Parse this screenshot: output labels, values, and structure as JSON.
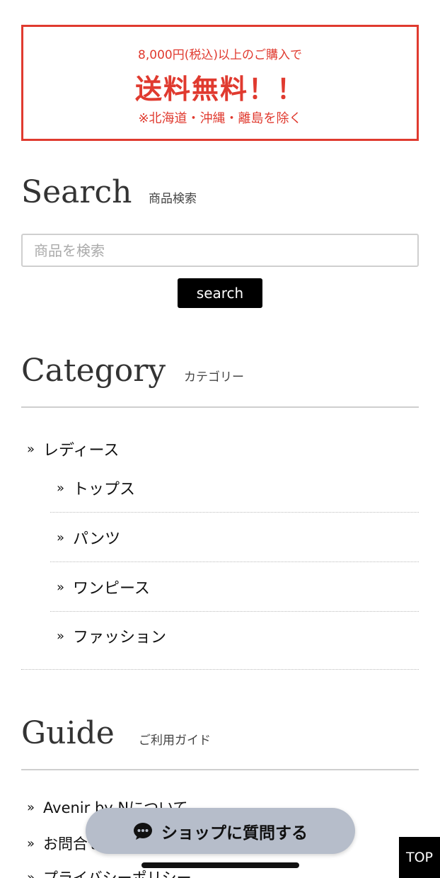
{
  "banner": {
    "line1": "8,000円(税込)以上のご購入で",
    "line2": "送料無料！！",
    "line3": "※北海道・沖縄・離島を除く",
    "color": "#e03a2f"
  },
  "search": {
    "title": "Search",
    "subtitle": "商品検索",
    "placeholder": "商品を検索",
    "button_label": "search"
  },
  "category": {
    "title": "Category",
    "subtitle": "カテゴリー",
    "parent": "レディース",
    "children": [
      "トップス",
      "パンツ",
      "ワンピース",
      "ファッション"
    ]
  },
  "guide": {
    "title": "Guide",
    "subtitle": "ご利用ガイド",
    "items": [
      "Avenir by Nについて",
      "お問合せ",
      "プライバシーポリシー"
    ]
  },
  "chat": {
    "label": "ショップに質問する",
    "icon": "chat-bubble-icon"
  },
  "top_button": {
    "label": "TOP"
  },
  "raquo": "»"
}
